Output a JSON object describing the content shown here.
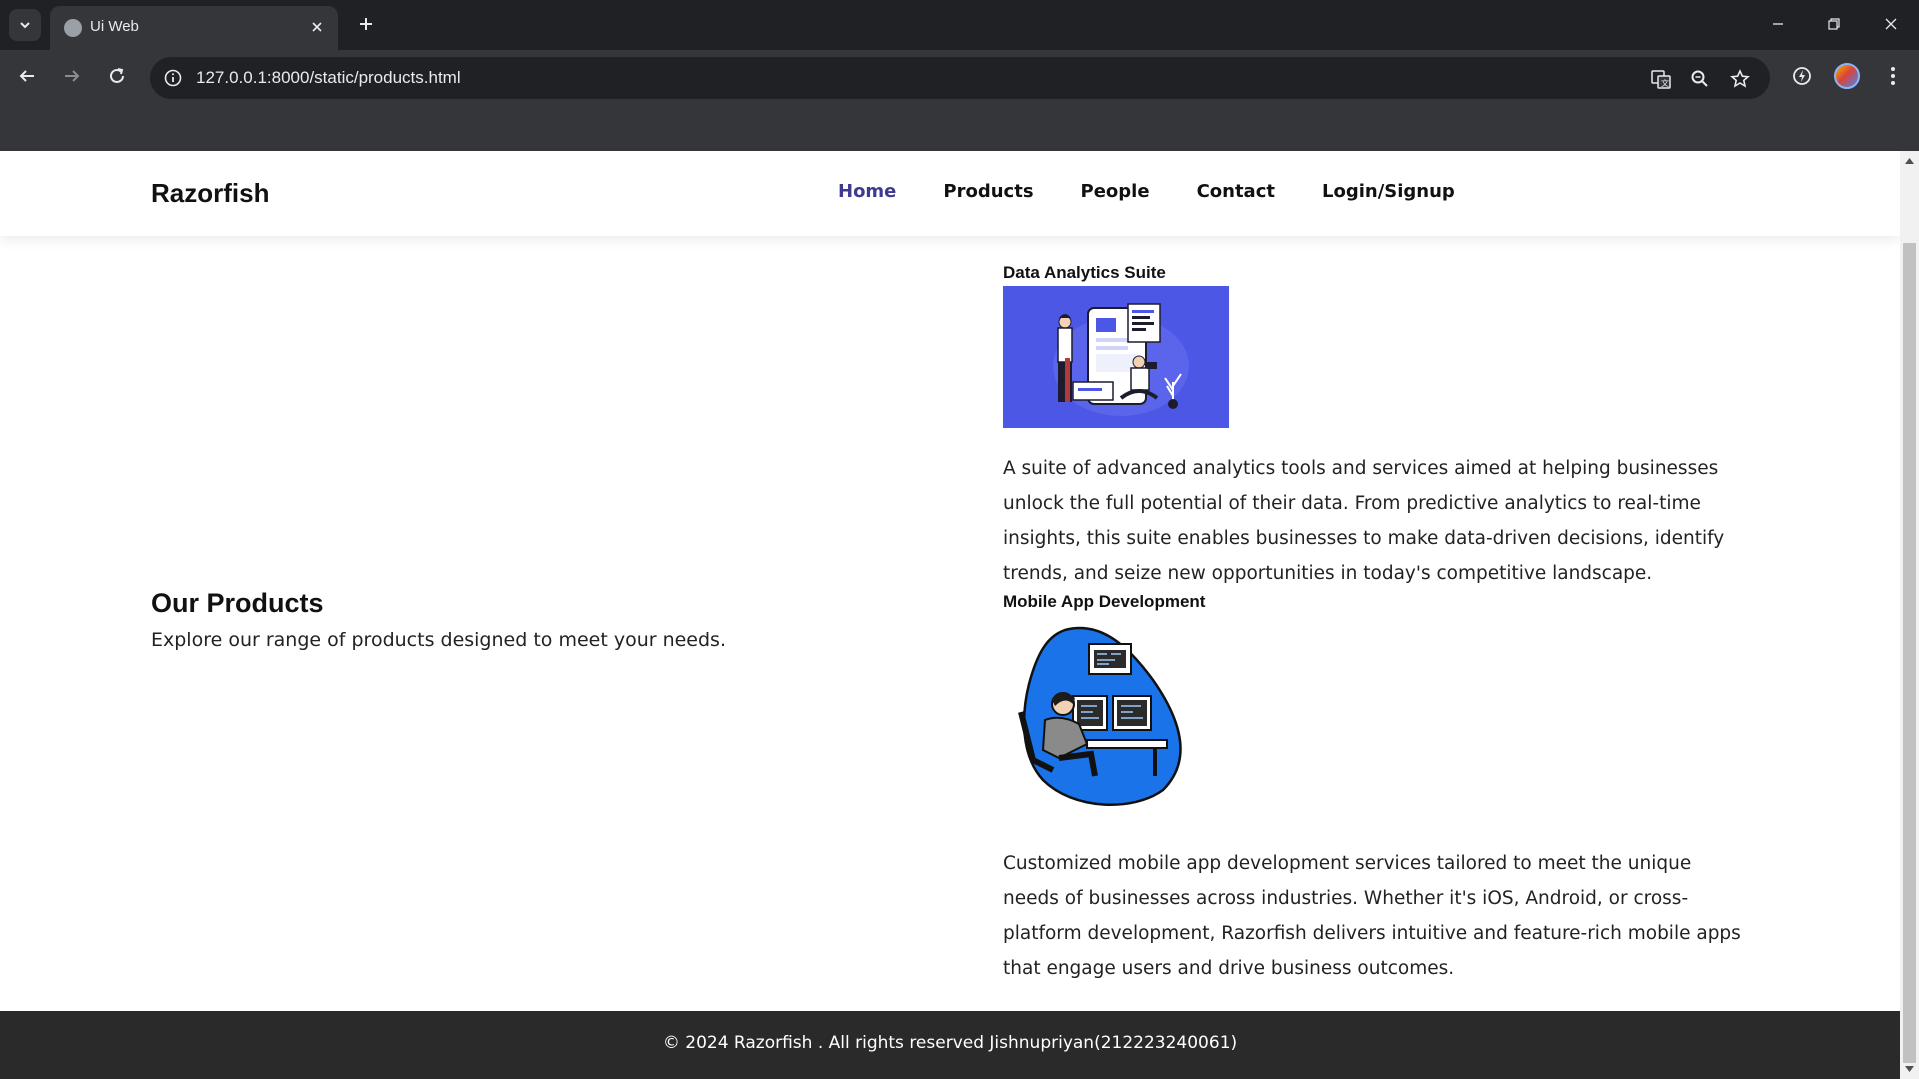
{
  "browser": {
    "tab_title": "Ui Web",
    "url": "127.0.0.1:8000/static/products.html"
  },
  "site": {
    "brand": "Razorfish",
    "nav": [
      {
        "label": "Home",
        "active": true
      },
      {
        "label": "Products",
        "active": false
      },
      {
        "label": "People",
        "active": false
      },
      {
        "label": "Contact",
        "active": false
      },
      {
        "label": "Login/Signup",
        "active": false
      }
    ]
  },
  "intro": {
    "title": "Our Products",
    "subtitle": "Explore our range of products designed to meet your needs."
  },
  "products": [
    {
      "name": "Data Analytics Suite",
      "description": "A suite of advanced analytics tools and services aimed at helping businesses unlock the full potential of their data. From predictive analytics to real-time insights, this suite enables businesses to make data-driven decisions, identify trends, and seize new opportunities in today's competitive landscape."
    },
    {
      "name": "Mobile App Development",
      "description": "Customized mobile app development services tailored to meet the unique needs of businesses across industries. Whether it's iOS, Android, or cross-platform development, Razorfish delivers intuitive and feature-rich mobile apps that engage users and drive business outcomes."
    }
  ],
  "footer": {
    "text": "© 2024 Razorfish . All rights reserved Jishnupriyan(212223240061)"
  },
  "colors": {
    "nav_active": "#3d3a8f",
    "illustration_blue": "#4c57e5",
    "dev_blue": "#1a73e8",
    "footer_bg": "#2a2a2a"
  }
}
